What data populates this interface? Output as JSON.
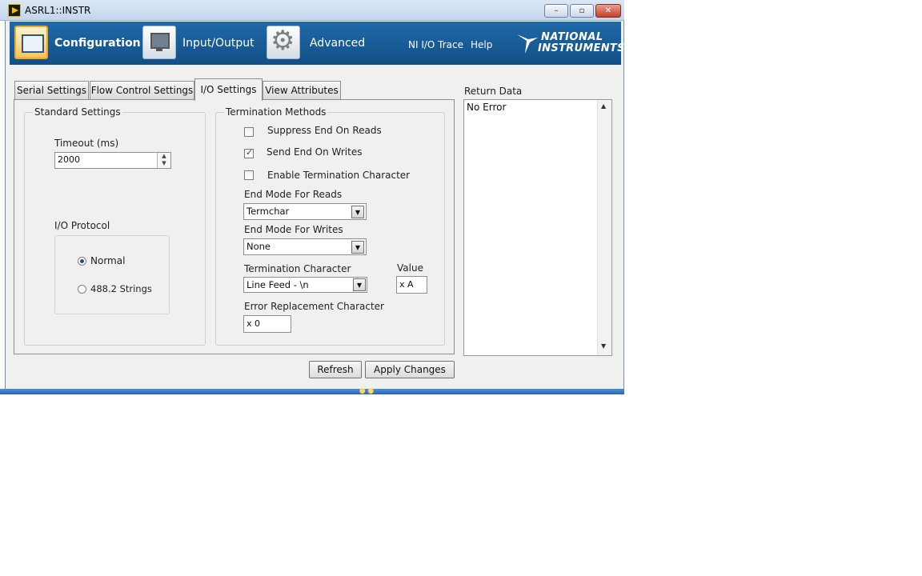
{
  "window": {
    "title": "ASRL1::INSTR",
    "minimize": "–",
    "maximize": "▫",
    "close": "✕"
  },
  "header": {
    "nav": [
      {
        "label": "Configuration",
        "icon": "configuration-icon"
      },
      {
        "label": "Input/Output",
        "icon": "monitor-icon"
      },
      {
        "label": "Advanced",
        "icon": "gear-icon"
      }
    ],
    "links": {
      "ni_io_trace": "NI I/O Trace",
      "help": "Help"
    },
    "logo": {
      "line1": "NATIONAL",
      "line2": "INSTRUMENTS"
    }
  },
  "tabs": [
    {
      "label": "Serial Settings",
      "active": false
    },
    {
      "label": "Flow Control Settings",
      "active": false
    },
    {
      "label": "I/O Settings",
      "active": true
    },
    {
      "label": "View Attributes",
      "active": false
    }
  ],
  "standard": {
    "title": "Standard Settings",
    "timeout_label": "Timeout (ms)",
    "timeout_value": "2000",
    "protocol_label": "I/O Protocol",
    "protocol_options": [
      "Normal",
      "488.2 Strings"
    ],
    "protocol_selected": "Normal"
  },
  "termination": {
    "title": "Termination Methods",
    "checks": [
      {
        "label": "Suppress End On Reads",
        "checked": false
      },
      {
        "label": "Send End On Writes",
        "checked": true
      },
      {
        "label": "Enable Termination Character",
        "checked": false
      }
    ],
    "end_mode_reads_label": "End Mode For Reads",
    "end_mode_reads_value": "Termchar",
    "end_mode_writes_label": "End Mode For Writes",
    "end_mode_writes_value": "None",
    "term_char_label": "Termination Character",
    "term_char_value": "Line Feed - \\n",
    "value_label": "Value",
    "value_value": "x A",
    "error_repl_label": "Error Replacement Character",
    "error_repl_value": "x 0"
  },
  "return_data": {
    "label": "Return Data",
    "text": "No Error"
  },
  "buttons": {
    "refresh": "Refresh",
    "apply": "Apply Changes"
  },
  "colors": {
    "header_blue": "#1a5f9e",
    "accent_orange": "#f2a623"
  }
}
